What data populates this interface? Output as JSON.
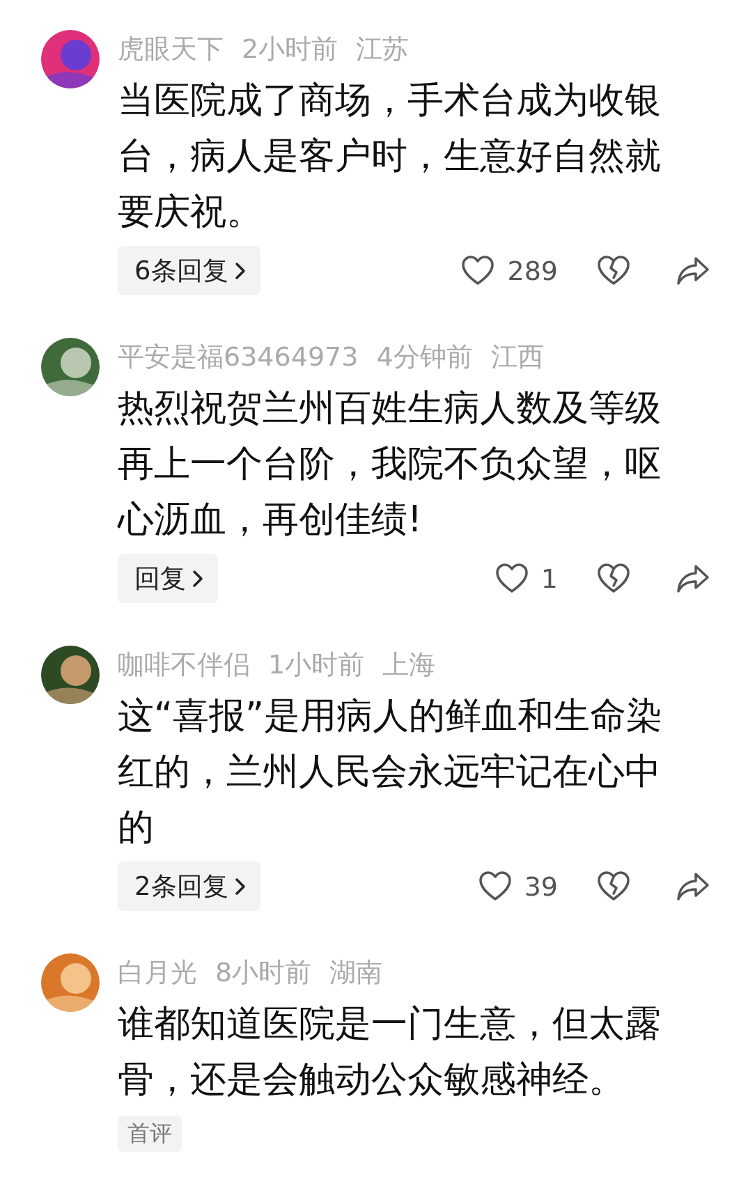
{
  "comments": [
    {
      "user": "虎眼天下",
      "time": "2小时前",
      "location": "江苏",
      "text": "当医院成了商场，手术台成为收银台，病人是客户时，生意好自然就要庆祝。",
      "reply_label": "6条回复",
      "likes": "289"
    },
    {
      "user": "平安是福63464973",
      "time": "4分钟前",
      "location": "江西",
      "text": "热烈祝贺兰州百姓生病人数及等级再上一个台阶，我院不负众望，呕心沥血，再创佳绩!",
      "reply_label": "回复",
      "likes": "1"
    },
    {
      "user": "咖啡不伴侣",
      "time": "1小时前",
      "location": "上海",
      "text": "这“喜报”是用病人的鲜血和生命染红的，兰州人民会永远牢记在心中的",
      "reply_label": "2条回复",
      "likes": "39"
    },
    {
      "user": "白月光",
      "time": "8小时前",
      "location": "湖南",
      "text": "谁都知道医院是一门生意，但太露骨，还是会触动公众敏感神经。",
      "badge": "首评"
    }
  ]
}
